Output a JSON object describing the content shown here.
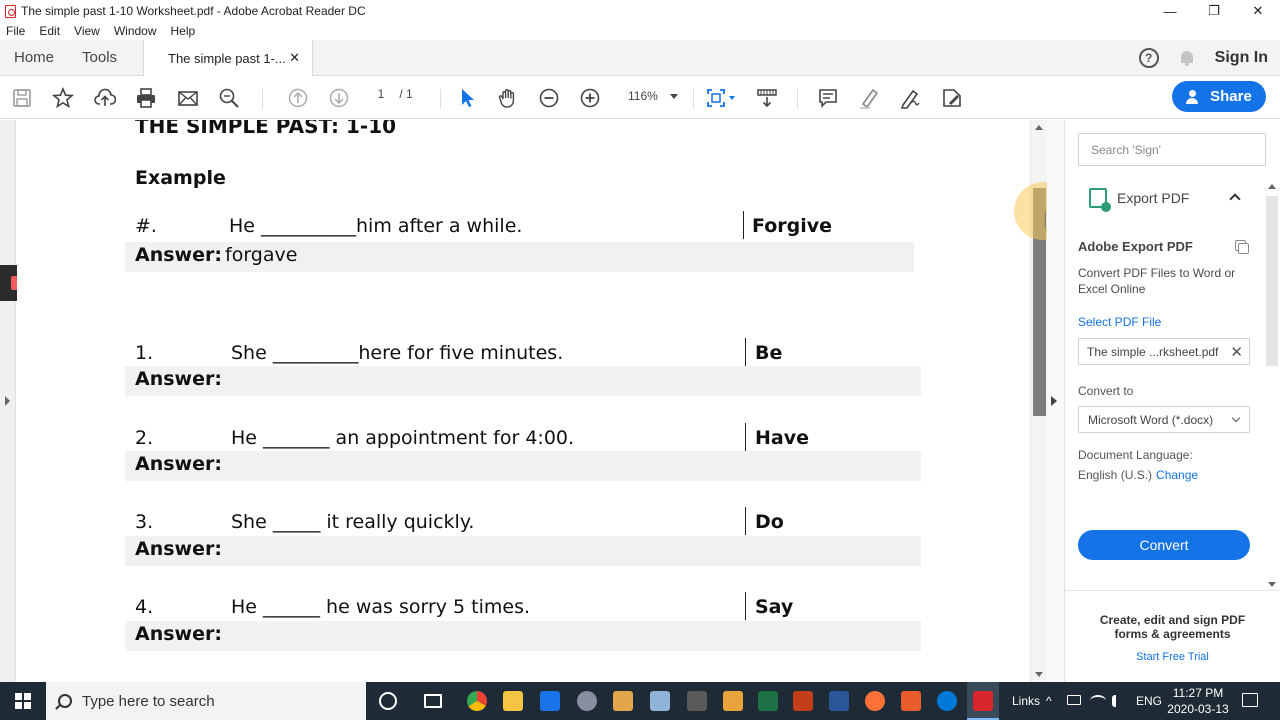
{
  "window": {
    "title": "The simple past 1-10 Worksheet.pdf - Adobe Acrobat Reader DC",
    "controls": {
      "minimize": "—",
      "maximize": "❐",
      "close": "✕"
    }
  },
  "menu": [
    "File",
    "Edit",
    "View",
    "Window",
    "Help"
  ],
  "tabs": {
    "home": "Home",
    "tools": "Tools",
    "document": "The simple past 1-...",
    "close": "✕",
    "help": "?",
    "signin": "Sign In"
  },
  "toolbar": {
    "page_current": "1",
    "page_total": "/  1",
    "zoom": "116%",
    "share_label": "Share",
    "icons": [
      "save-icon",
      "star-icon",
      "upload-icon",
      "print-icon",
      "mail-icon",
      "find-icon",
      "prev-page-icon",
      "next-page-icon",
      "select-arrow-icon",
      "hand-icon",
      "zoom-out-icon",
      "zoom-in-icon",
      "fit-page-icon",
      "scroll-mode-icon",
      "comment-icon",
      "highlight-icon",
      "sign-icon",
      "fill-sign-icon"
    ]
  },
  "document": {
    "heading": "THE SIMPLE PAST:  1-10",
    "example_label": "Example",
    "answer_label": "Answer:",
    "items": [
      {
        "num": "#.",
        "sentence": "He __________him after a while.",
        "verb": "Forgive",
        "answer": "forgave"
      },
      {
        "num": "1.",
        "sentence": "She _________here for five minutes.",
        "verb": "Be",
        "answer": ""
      },
      {
        "num": "2.",
        "sentence": "He _______ an appointment for 4:00.",
        "verb": "Have",
        "answer": ""
      },
      {
        "num": "3.",
        "sentence": "She _____ it really quickly.",
        "verb": "Do",
        "answer": ""
      },
      {
        "num": "4.",
        "sentence": "He ______ he was sorry 5 times.",
        "verb": "Say",
        "answer": ""
      }
    ]
  },
  "sidepanel": {
    "search_placeholder": "Search 'Sign'",
    "section": "Export PDF",
    "title": "Adobe Export PDF",
    "description": "Convert PDF Files to Word or Excel Online",
    "select_link": "Select PDF File",
    "file_name": "The simple ...rksheet.pdf",
    "convert_to_label": "Convert to",
    "convert_to_value": "Microsoft Word (*.docx)",
    "doc_lang_label": "Document Language:",
    "doc_lang_value": "English (U.S.)",
    "change_link": "Change",
    "convert_button": "Convert",
    "promo": "Create, edit and sign PDF forms & agreements",
    "trial_link": "Start Free Trial"
  },
  "taskbar": {
    "search_placeholder": "Type here to search",
    "links": "Links",
    "lang": "ENG",
    "time": "11:27 PM",
    "date": "2020-03-13"
  }
}
